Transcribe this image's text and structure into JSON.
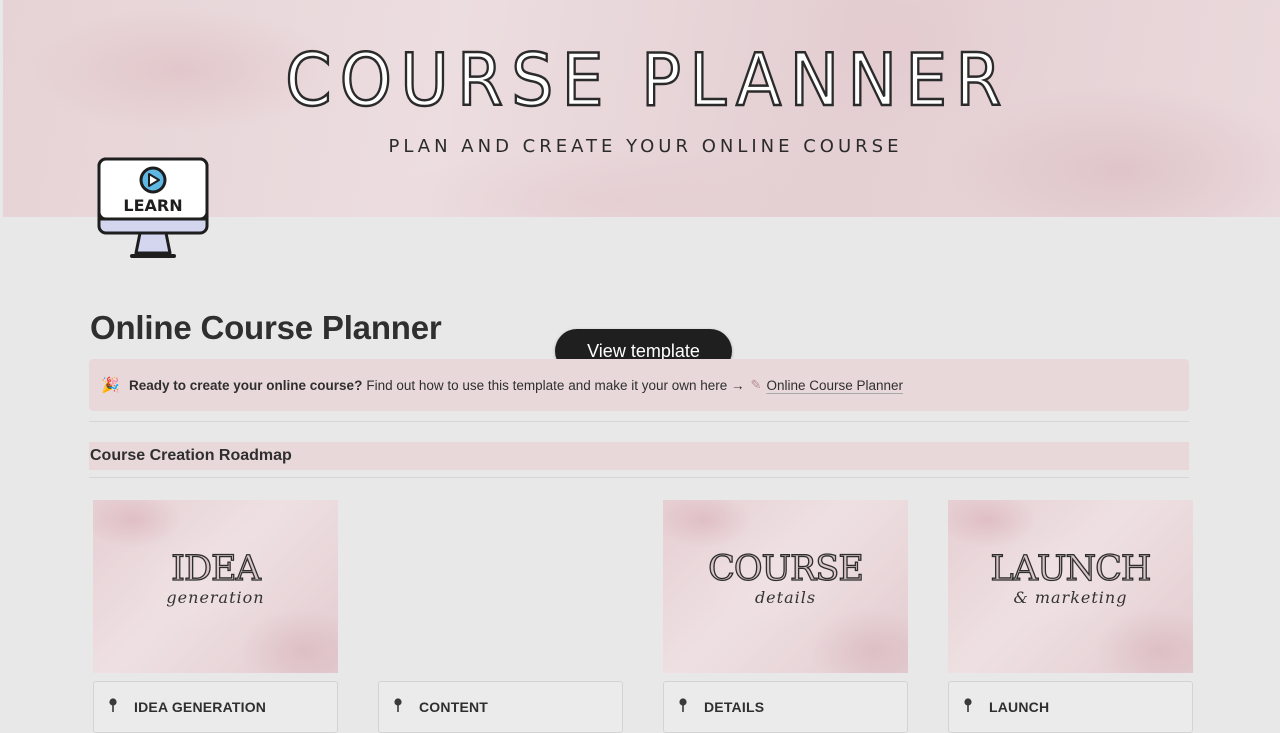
{
  "cover": {
    "title": "COURSE PLANNER",
    "subtitle": "PLAN AND CREATE YOUR ONLINE COURSE",
    "icon": "monitor-learn-icon",
    "icon_text": "LEARN"
  },
  "page": {
    "title": "Online Course Planner"
  },
  "overlay": {
    "view_template_label": "View template"
  },
  "callout": {
    "icon": "party-popper-icon",
    "bold_text": "Ready to create your online course?",
    "text": "Find out how to use this template and make it your own here →",
    "link_icon": "page-link-icon",
    "link_text": "Online Course Planner"
  },
  "roadmap": {
    "heading": "Course Creation Roadmap",
    "cards": [
      {
        "image_title": "IDEA",
        "image_script": "generation",
        "label": "IDEA GENERATION",
        "icon": "pin-icon",
        "has_image": true
      },
      {
        "image_title": "",
        "image_script": "",
        "label": "CONTENT",
        "icon": "pin-icon",
        "has_image": false
      },
      {
        "image_title": "COURSE",
        "image_script": "details",
        "label": "DETAILS",
        "icon": "pin-icon",
        "has_image": true
      },
      {
        "image_title": "LAUNCH",
        "image_script": "& marketing",
        "label": "LAUNCH",
        "icon": "pin-icon",
        "has_image": true
      }
    ]
  },
  "colors": {
    "cover_tint": "#e6d3d5",
    "callout_background": "#e9d8da",
    "page_background": "#e8e8e8",
    "button_dark": "#1f1f1f"
  }
}
